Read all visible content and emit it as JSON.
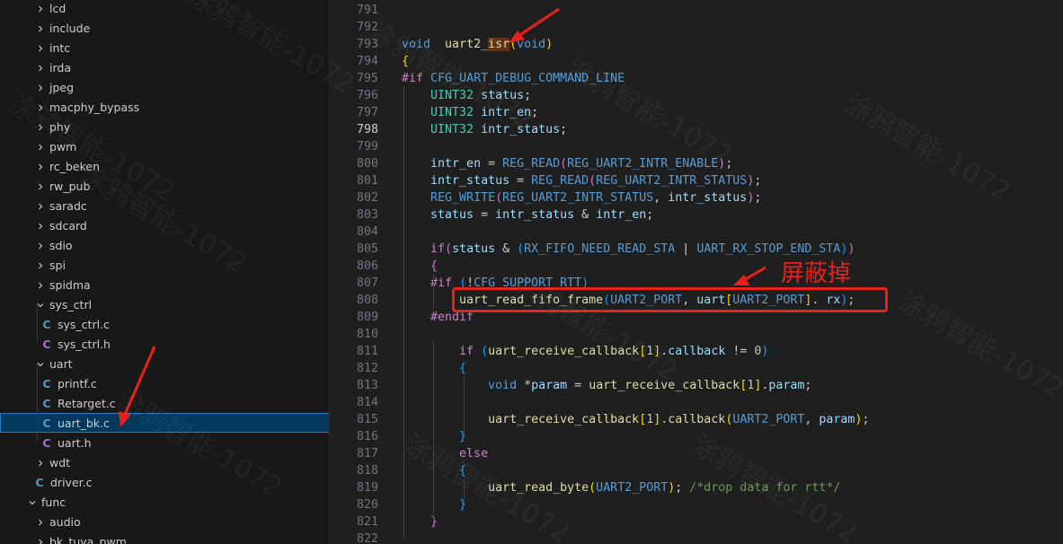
{
  "explorer": {
    "items": [
      {
        "label": "lcd",
        "type": "folder",
        "open": false,
        "depth": 1
      },
      {
        "label": "include",
        "type": "folder",
        "open": false,
        "depth": 1
      },
      {
        "label": "intc",
        "type": "folder",
        "open": false,
        "depth": 1
      },
      {
        "label": "irda",
        "type": "folder",
        "open": false,
        "depth": 1
      },
      {
        "label": "jpeg",
        "type": "folder",
        "open": false,
        "depth": 1
      },
      {
        "label": "macphy_bypass",
        "type": "folder",
        "open": false,
        "depth": 1
      },
      {
        "label": "phy",
        "type": "folder",
        "open": false,
        "depth": 1
      },
      {
        "label": "pwm",
        "type": "folder",
        "open": false,
        "depth": 1
      },
      {
        "label": "rc_beken",
        "type": "folder",
        "open": false,
        "depth": 1
      },
      {
        "label": "rw_pub",
        "type": "folder",
        "open": false,
        "depth": 1
      },
      {
        "label": "saradc",
        "type": "folder",
        "open": false,
        "depth": 1
      },
      {
        "label": "sdcard",
        "type": "folder",
        "open": false,
        "depth": 1
      },
      {
        "label": "sdio",
        "type": "folder",
        "open": false,
        "depth": 1
      },
      {
        "label": "spi",
        "type": "folder",
        "open": false,
        "depth": 1
      },
      {
        "label": "spidma",
        "type": "folder",
        "open": false,
        "depth": 1
      },
      {
        "label": "sys_ctrl",
        "type": "folder",
        "open": true,
        "depth": 1
      },
      {
        "label": "sys_ctrl.c",
        "type": "c",
        "depth": 2
      },
      {
        "label": "sys_ctrl.h",
        "type": "h",
        "depth": 2
      },
      {
        "label": "uart",
        "type": "folder",
        "open": true,
        "depth": 1
      },
      {
        "label": "printf.c",
        "type": "c",
        "depth": 2
      },
      {
        "label": "Retarget.c",
        "type": "c",
        "depth": 2
      },
      {
        "label": "uart_bk.c",
        "type": "c",
        "depth": 2,
        "selected": true
      },
      {
        "label": "uart.h",
        "type": "h",
        "depth": 2
      },
      {
        "label": "wdt",
        "type": "folder",
        "open": false,
        "depth": 1
      },
      {
        "label": "driver.c",
        "type": "c",
        "depth": 1
      },
      {
        "label": "func",
        "type": "folder",
        "open": true,
        "depth": 0
      },
      {
        "label": "audio",
        "type": "folder",
        "open": false,
        "depth": 1
      },
      {
        "label": "bk_tuya_pwm",
        "type": "folder",
        "open": false,
        "depth": 1
      }
    ]
  },
  "editor": {
    "active_line": "798",
    "lines": [
      {
        "n": "791",
        "tokens": []
      },
      {
        "n": "792",
        "tokens": []
      },
      {
        "n": "793",
        "tokens": [
          [
            "kw",
            "void"
          ],
          [
            "",
            "  "
          ],
          [
            "fn",
            "uart2_"
          ],
          [
            "fnhl",
            "isr"
          ],
          [
            "p1",
            "("
          ],
          [
            "kw",
            "void"
          ],
          [
            "p1",
            ")"
          ]
        ]
      },
      {
        "n": "794",
        "tokens": [
          [
            "p1",
            "{"
          ]
        ]
      },
      {
        "n": "795",
        "tokens": [
          [
            "pp",
            "#if"
          ],
          [
            "",
            " "
          ],
          [
            "mac",
            "CFG_UART_DEBUG_COMMAND_LINE"
          ]
        ]
      },
      {
        "n": "796",
        "tokens": [
          [
            "",
            "    "
          ],
          [
            "typ",
            "UINT32"
          ],
          [
            "",
            " "
          ],
          [
            "var",
            "status"
          ],
          [
            "",
            ";"
          ]
        ]
      },
      {
        "n": "797",
        "tokens": [
          [
            "",
            "    "
          ],
          [
            "typ",
            "UINT32"
          ],
          [
            "",
            " "
          ],
          [
            "var",
            "intr_en"
          ],
          [
            "",
            ";"
          ]
        ]
      },
      {
        "n": "798",
        "tokens": [
          [
            "",
            "    "
          ],
          [
            "typ",
            "UINT32"
          ],
          [
            "",
            " "
          ],
          [
            "var",
            "intr_status"
          ],
          [
            "",
            ";"
          ]
        ]
      },
      {
        "n": "799",
        "tokens": []
      },
      {
        "n": "800",
        "tokens": [
          [
            "",
            "    "
          ],
          [
            "var",
            "intr_en"
          ],
          [
            "",
            " = "
          ],
          [
            "mac",
            "REG_READ"
          ],
          [
            "p2",
            "("
          ],
          [
            "mac",
            "REG_UART2_INTR_ENABLE"
          ],
          [
            "p2",
            ")"
          ],
          [
            "",
            ";"
          ]
        ]
      },
      {
        "n": "801",
        "tokens": [
          [
            "",
            "    "
          ],
          [
            "var",
            "intr_status"
          ],
          [
            "",
            " = "
          ],
          [
            "mac",
            "REG_READ"
          ],
          [
            "p2",
            "("
          ],
          [
            "mac",
            "REG_UART2_INTR_STATUS"
          ],
          [
            "p2",
            ")"
          ],
          [
            "",
            ";"
          ]
        ]
      },
      {
        "n": "802",
        "tokens": [
          [
            "",
            "    "
          ],
          [
            "mac",
            "REG_WRITE"
          ],
          [
            "p2",
            "("
          ],
          [
            "mac",
            "REG_UART2_INTR_STATUS"
          ],
          [
            "",
            ", "
          ],
          [
            "var",
            "intr_status"
          ],
          [
            "p2",
            ")"
          ],
          [
            "",
            ";"
          ]
        ]
      },
      {
        "n": "803",
        "tokens": [
          [
            "",
            "    "
          ],
          [
            "var",
            "status"
          ],
          [
            "",
            " = "
          ],
          [
            "var",
            "intr_status"
          ],
          [
            "",
            " & "
          ],
          [
            "var",
            "intr_en"
          ],
          [
            "",
            ";"
          ]
        ]
      },
      {
        "n": "804",
        "tokens": []
      },
      {
        "n": "805",
        "tokens": [
          [
            "",
            "    "
          ],
          [
            "ctl",
            "if"
          ],
          [
            "p2",
            "("
          ],
          [
            "var",
            "status"
          ],
          [
            "",
            " & "
          ],
          [
            "p3",
            "("
          ],
          [
            "mac",
            "RX_FIFO_NEED_READ_STA"
          ],
          [
            "",
            " | "
          ],
          [
            "mac",
            "UART_RX_STOP_END_STA"
          ],
          [
            "p3",
            ")"
          ],
          [
            "p2",
            ")"
          ]
        ]
      },
      {
        "n": "806",
        "tokens": [
          [
            "",
            "    "
          ],
          [
            "p2",
            "{"
          ]
        ]
      },
      {
        "n": "807",
        "tokens": [
          [
            "",
            "    "
          ],
          [
            "pp",
            "#if"
          ],
          [
            "",
            " "
          ],
          [
            "p3",
            "("
          ],
          [
            "",
            "!"
          ],
          [
            "mac",
            "CFG_SUPPORT_RTT"
          ],
          [
            "p3",
            ")"
          ]
        ]
      },
      {
        "n": "808",
        "tokens": [
          [
            "",
            "        "
          ],
          [
            "fn",
            "uart_read_fifo_frame"
          ],
          [
            "p3",
            "("
          ],
          [
            "mac",
            "UART2_PORT"
          ],
          [
            "",
            ", "
          ],
          [
            "var",
            "uart"
          ],
          [
            "p1",
            "["
          ],
          [
            "mac",
            "UART2_PORT"
          ],
          [
            "p1",
            "]"
          ],
          [
            "",
            ". "
          ],
          [
            "var",
            "rx"
          ],
          [
            "p3",
            ")"
          ],
          [
            "",
            ";"
          ]
        ]
      },
      {
        "n": "809",
        "tokens": [
          [
            "",
            "    "
          ],
          [
            "pp",
            "#endif"
          ]
        ]
      },
      {
        "n": "810",
        "tokens": []
      },
      {
        "n": "811",
        "tokens": [
          [
            "",
            "        "
          ],
          [
            "ctl",
            "if"
          ],
          [
            "",
            " "
          ],
          [
            "p3",
            "("
          ],
          [
            "fn",
            "uart_receive_callback"
          ],
          [
            "p1",
            "["
          ],
          [
            "num",
            "1"
          ],
          [
            "p1",
            "]"
          ],
          [
            "",
            "."
          ],
          [
            "var",
            "callback"
          ],
          [
            "",
            " != "
          ],
          [
            "num",
            "0"
          ],
          [
            "p3",
            ")"
          ]
        ]
      },
      {
        "n": "812",
        "tokens": [
          [
            "",
            "        "
          ],
          [
            "p3",
            "{"
          ]
        ]
      },
      {
        "n": "813",
        "tokens": [
          [
            "",
            "            "
          ],
          [
            "kw",
            "void"
          ],
          [
            "",
            " *"
          ],
          [
            "var",
            "param"
          ],
          [
            "",
            " = "
          ],
          [
            "fn",
            "uart_receive_callback"
          ],
          [
            "p1",
            "["
          ],
          [
            "num",
            "1"
          ],
          [
            "p1",
            "]"
          ],
          [
            "",
            "."
          ],
          [
            "var",
            "param"
          ],
          [
            "",
            ";"
          ]
        ]
      },
      {
        "n": "814",
        "tokens": []
      },
      {
        "n": "815",
        "tokens": [
          [
            "",
            "            "
          ],
          [
            "fn",
            "uart_receive_callback"
          ],
          [
            "p1",
            "["
          ],
          [
            "num",
            "1"
          ],
          [
            "p1",
            "]"
          ],
          [
            "",
            "."
          ],
          [
            "fn",
            "callback"
          ],
          [
            "p1",
            "("
          ],
          [
            "mac",
            "UART2_PORT"
          ],
          [
            "",
            ", "
          ],
          [
            "var",
            "param"
          ],
          [
            "p1",
            ")"
          ],
          [
            "",
            ";"
          ]
        ]
      },
      {
        "n": "816",
        "tokens": [
          [
            "",
            "        "
          ],
          [
            "p3",
            "}"
          ]
        ]
      },
      {
        "n": "817",
        "tokens": [
          [
            "",
            "        "
          ],
          [
            "ctl",
            "else"
          ]
        ]
      },
      {
        "n": "818",
        "tokens": [
          [
            "",
            "        "
          ],
          [
            "p3",
            "{"
          ]
        ]
      },
      {
        "n": "819",
        "tokens": [
          [
            "",
            "            "
          ],
          [
            "fn",
            "uart_read_byte"
          ],
          [
            "p1",
            "("
          ],
          [
            "mac",
            "UART2_PORT"
          ],
          [
            "p1",
            ")"
          ],
          [
            "",
            "; "
          ],
          [
            "cmt",
            "/*drop data for rtt*/"
          ]
        ]
      },
      {
        "n": "820",
        "tokens": [
          [
            "",
            "        "
          ],
          [
            "p3",
            "}"
          ]
        ]
      },
      {
        "n": "821",
        "tokens": [
          [
            "",
            "    "
          ],
          [
            "p2",
            "}"
          ]
        ]
      },
      {
        "n": "822",
        "tokens": []
      }
    ]
  },
  "annotation": {
    "text": "屏蔽掉",
    "color": "#e8211b"
  },
  "watermark": {
    "text": "涂鸦智能-1072"
  }
}
